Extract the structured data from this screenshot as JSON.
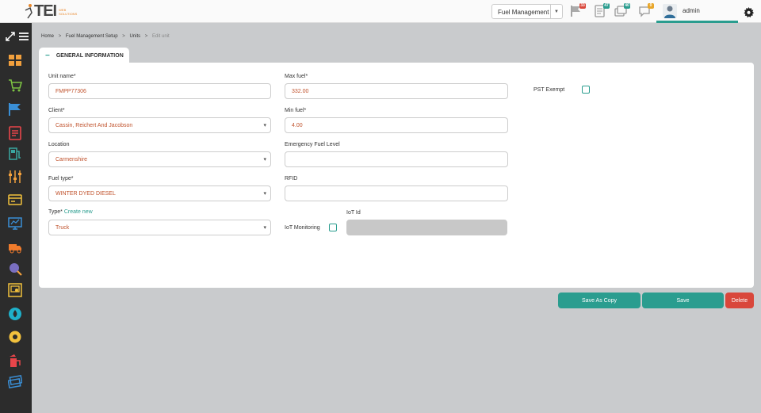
{
  "app": {
    "logo_text": "TEI",
    "logo_sub_line1": "WEB",
    "logo_sub_line2": "SOLUTIONS"
  },
  "topbar": {
    "module_selected": "Fuel Management",
    "notifications": [
      {
        "icon": "flag-icon",
        "count": "33",
        "color": "#d9473b"
      },
      {
        "icon": "document-icon",
        "count": "47",
        "color": "#2a9d8f"
      },
      {
        "icon": "cards-icon",
        "count": "40",
        "color": "#2a9d8f"
      },
      {
        "icon": "chat-icon",
        "count": "0",
        "color": "#e8a62a"
      }
    ],
    "user_name": "admin"
  },
  "breadcrumb": {
    "items": [
      "Home",
      "Fuel Management Setup",
      "Units"
    ],
    "current": "Edit unit",
    "separator": ">"
  },
  "section": {
    "tab_label": "GENERAL INFORMATION",
    "tab_toggle": "−"
  },
  "form": {
    "unit_name": {
      "label": "Unit name*",
      "value": "FMPP77306"
    },
    "client": {
      "label": "Client*",
      "value": "Cassin, Reichert And Jacobson"
    },
    "location": {
      "label": "Location",
      "value": "Carmenshire"
    },
    "fuel_type": {
      "label": "Fuel type*",
      "value": "WINTER DYED DIESEL"
    },
    "type": {
      "label": "Type*",
      "create_link": "Create new",
      "value": "Truck"
    },
    "max_fuel": {
      "label": "Max fuel*",
      "value": "332.00"
    },
    "min_fuel": {
      "label": "Min fuel*",
      "value": "4.00"
    },
    "emergency_fuel": {
      "label": "Emergency Fuel Level",
      "value": ""
    },
    "rfid": {
      "label": "RFID",
      "value": ""
    },
    "iot_monitoring": {
      "label": "IoT Monitoring",
      "checked": false
    },
    "iot_id": {
      "label": "IoT Id",
      "value": ""
    },
    "pst_exempt": {
      "label": "PST Exempt",
      "checked": false
    }
  },
  "actions": {
    "save_as_copy": "Save As Copy",
    "save": "Save",
    "delete": "Delete"
  },
  "colors": {
    "accent": "#2a9d8f",
    "danger": "#d9473b",
    "value_text": "#c0522c",
    "sidebar": "#2c2c2c"
  },
  "sidebar": {
    "items": [
      "dashboard-icon",
      "cart-icon",
      "flag-icon",
      "report-icon",
      "fuel-station-icon",
      "sliders-icon",
      "payment-icon",
      "monitor-chart-icon",
      "truck-icon",
      "search-globe-icon",
      "screen-icon",
      "droplet-icon",
      "settings-cog-icon",
      "pump-icon",
      "cards-stack-icon"
    ]
  }
}
